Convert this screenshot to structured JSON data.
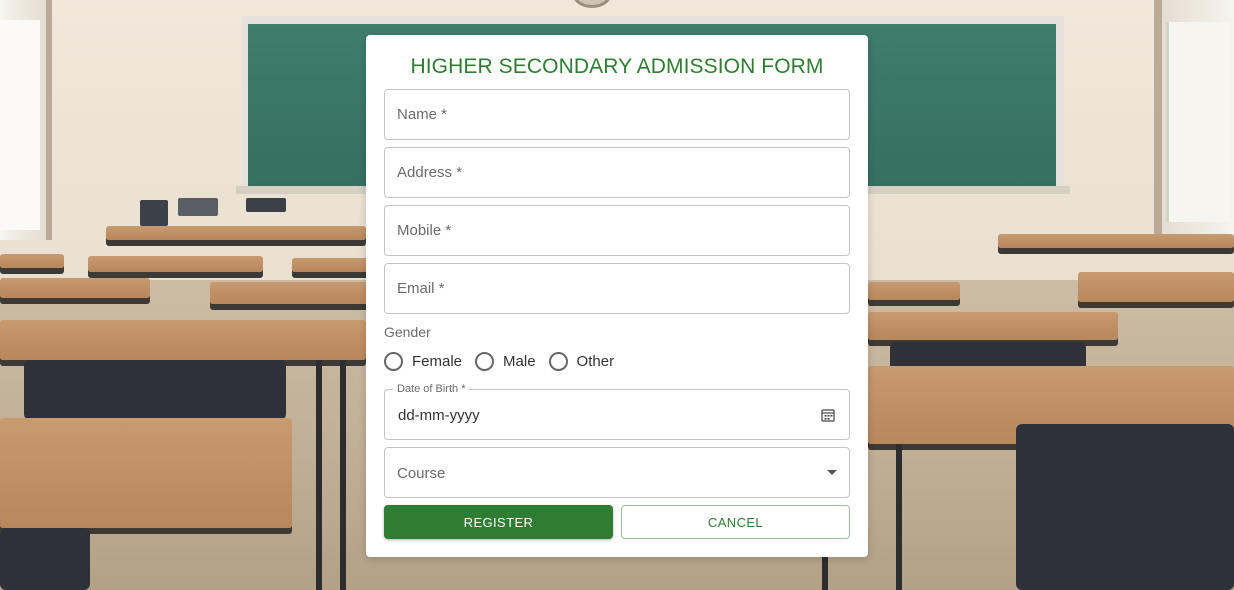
{
  "form": {
    "title": "HIGHER SECONDARY ADMISSION FORM",
    "fields": {
      "name": {
        "placeholder": "Name *",
        "value": ""
      },
      "address": {
        "placeholder": "Address *",
        "value": ""
      },
      "mobile": {
        "placeholder": "Mobile *",
        "value": ""
      },
      "email": {
        "placeholder": "Email *",
        "value": ""
      }
    },
    "gender": {
      "label": "Gender",
      "options": [
        "Female",
        "Male",
        "Other"
      ]
    },
    "dob": {
      "label": "Date of Birth *",
      "value": "dd-mm-yyyy",
      "icon": "calendar-icon"
    },
    "course": {
      "placeholder": "Course",
      "icon": "chevron-down-icon"
    },
    "buttons": {
      "register": "REGISTER",
      "cancel": "CANCEL"
    }
  },
  "colors": {
    "accent": "#2e7d32",
    "border": "#c4c4c4",
    "muted_text": "#6b6b6b"
  }
}
